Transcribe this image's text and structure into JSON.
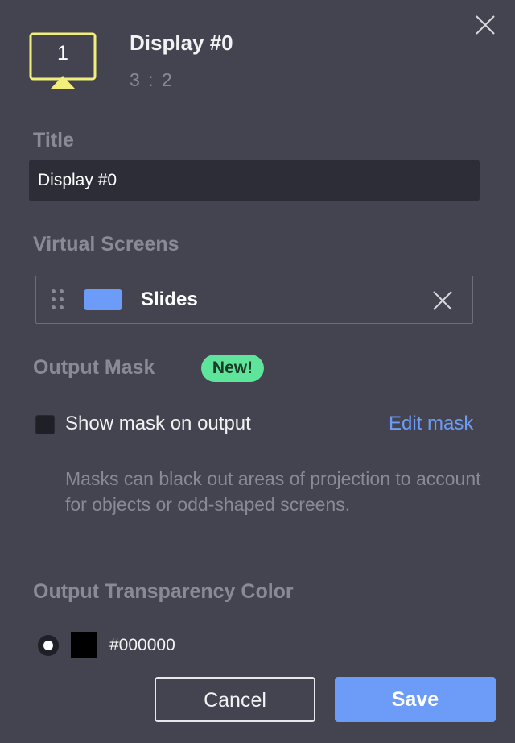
{
  "header": {
    "display_number": "1",
    "title": "Display #0",
    "aspect_ratio": "3 : 2",
    "icon_color": "#f2ee7c"
  },
  "title_section": {
    "label": "Title",
    "value": "Display #0"
  },
  "virtual_screens": {
    "label": "Virtual Screens",
    "items": [
      {
        "name": "Slides",
        "color": "#6c9cf7"
      }
    ]
  },
  "output_mask": {
    "label": "Output Mask",
    "badge": "New!",
    "checkbox_label": "Show mask on output",
    "checked": false,
    "edit_link": "Edit mask",
    "help_text": "Masks can black out areas of projection to account for objects or odd-shaped screens."
  },
  "transparency": {
    "label": "Output Transparency Color",
    "selected": true,
    "color": "#000000",
    "hex_label": "#000000"
  },
  "footer": {
    "cancel_label": "Cancel",
    "save_label": "Save"
  },
  "colors": {
    "background": "#444450",
    "accent": "#6c9cf7",
    "badge": "#5fe59b",
    "muted_text": "#8a8a96"
  }
}
